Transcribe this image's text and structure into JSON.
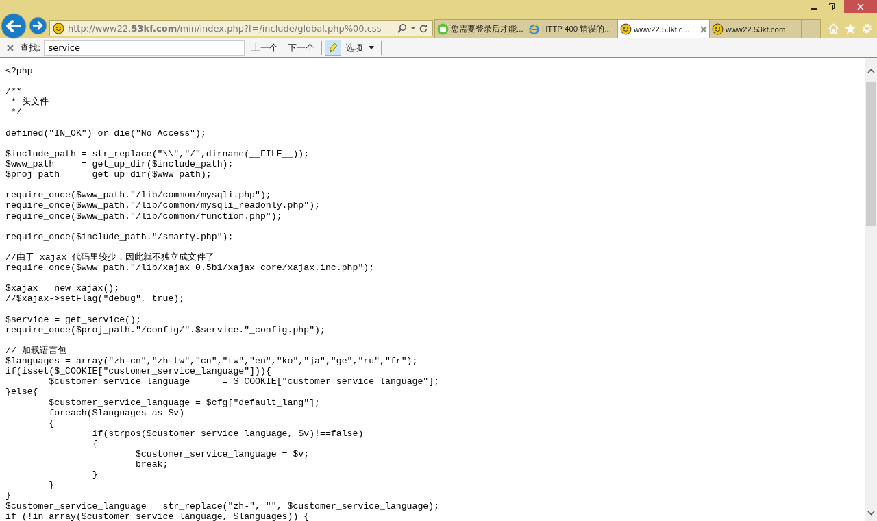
{
  "address_bar": {
    "url": "http://www22.**53kf.com**/min/index.php?f=/include/global.php%00.css"
  },
  "tabs": [
    {
      "title": "您需要登录后才能...",
      "selected": false,
      "kind": "green-badge"
    },
    {
      "title": "HTTP 400 错误的...",
      "selected": false,
      "kind": "ie"
    },
    {
      "title": "www22.53kf.c...",
      "selected": true,
      "kind": "smiley"
    },
    {
      "title": "www22.53kf.com",
      "selected": false,
      "kind": "smiley"
    }
  ],
  "find_bar": {
    "label": "查找:",
    "value": "service",
    "previous": "上一个",
    "next": "下一个",
    "highlight_on": true,
    "options": "选项"
  },
  "code_blocks": [
    [
      "<?php"
    ],
    [
      "/**",
      " * 头文件",
      " */"
    ],
    [
      "defined(\"IN_OK\") or die(\"No Access\");"
    ],
    [
      "$include_path = str_replace(\"\\\\\",\"/\",dirname(__FILE__));",
      "$www_path     = get_up_dir($include_path);",
      "$proj_path    = get_up_dir($www_path);"
    ],
    [
      "require_once($www_path.\"/lib/common/mysqli.php\");",
      "require_once($www_path.\"/lib/common/mysqli_readonly.php\");",
      "require_once($www_path.\"/lib/common/function.php\");"
    ],
    [
      "require_once($include_path.\"/smarty.php\");"
    ],
    [
      "//由于 xajax 代码里较少，因此就不独立成文件了",
      "require_once($www_path.\"/lib/xajax_0.5b1/xajax_core/xajax.inc.php\");"
    ],
    [
      "$xajax = new xajax();",
      "//$xajax->setFlag(\"debug\", true);"
    ],
    [
      "$service = get_service();",
      "require_once($proj_path.\"/config/\".$service.\"_config.php\");"
    ],
    [
      "// 加载语言包",
      "$languages = array(\"zh-cn\",\"zh-tw\",\"cn\",\"tw\",\"en\",\"ko\",\"ja\",\"ge\",\"ru\",\"fr\");",
      "if(isset($_COOKIE[\"customer_service_language\"])){",
      "\t$customer_service_language\t= $_COOKIE[\"customer_service_language\"];",
      "}else{",
      "\t$customer_service_language = $cfg[\"default_lang\"];",
      "\tforeach($languages as $v)",
      "\t{",
      "\t\tif(strpos($customer_service_language, $v)!==false)",
      "\t\t{",
      "\t\t\t$customer_service_language = $v;",
      "\t\t\tbreak;",
      "\t\t}",
      "\t}",
      "}",
      "$customer_service_language = str_replace(\"zh-\", \"\", $customer_service_language);",
      "if (!in_array($customer_service_language, $languages)) {"
    ]
  ]
}
